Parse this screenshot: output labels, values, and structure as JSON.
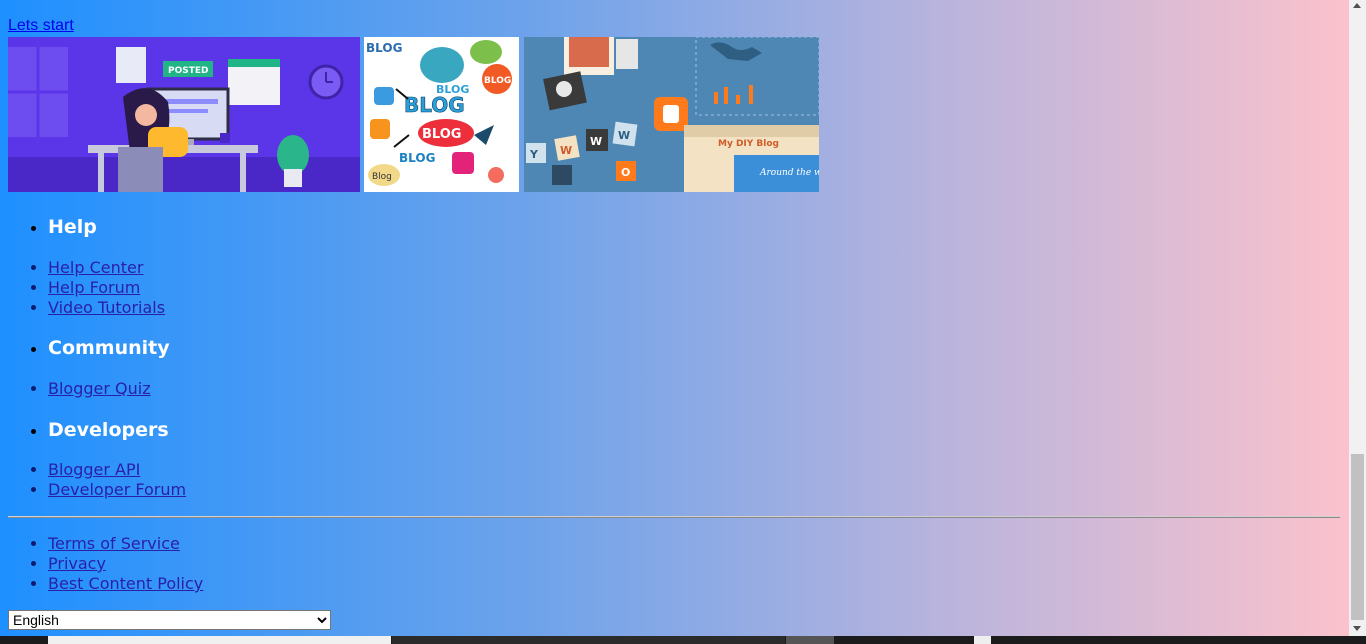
{
  "start_link": "Lets start",
  "images": {
    "img1_label": "POSTED",
    "img2_words": [
      "BLOG",
      "BLOG",
      "BLOG",
      "BLOG",
      "BLOG",
      "BLOG",
      "blog",
      "blog"
    ],
    "img3_letters": [
      "W",
      "W",
      "W",
      "Y",
      "O"
    ],
    "img3_caption": "My DIY Blog",
    "img3_caption2": "Around the w"
  },
  "sections": [
    {
      "heading": "Help",
      "links": [
        "Help Center",
        "Help Forum",
        "Video Tutorials"
      ]
    },
    {
      "heading": "Community",
      "links": [
        "Blogger Quiz"
      ]
    },
    {
      "heading": "Developers",
      "links": [
        "Blogger API",
        "Developer Forum"
      ]
    }
  ],
  "footer_links": [
    "Terms of Service",
    "Privacy",
    "Best Content Policy"
  ],
  "language": {
    "selected": "English"
  },
  "colors": {
    "gradient_start": "#1e90ff",
    "gradient_end": "#fbc2cc",
    "link": "#2a1fa8"
  }
}
